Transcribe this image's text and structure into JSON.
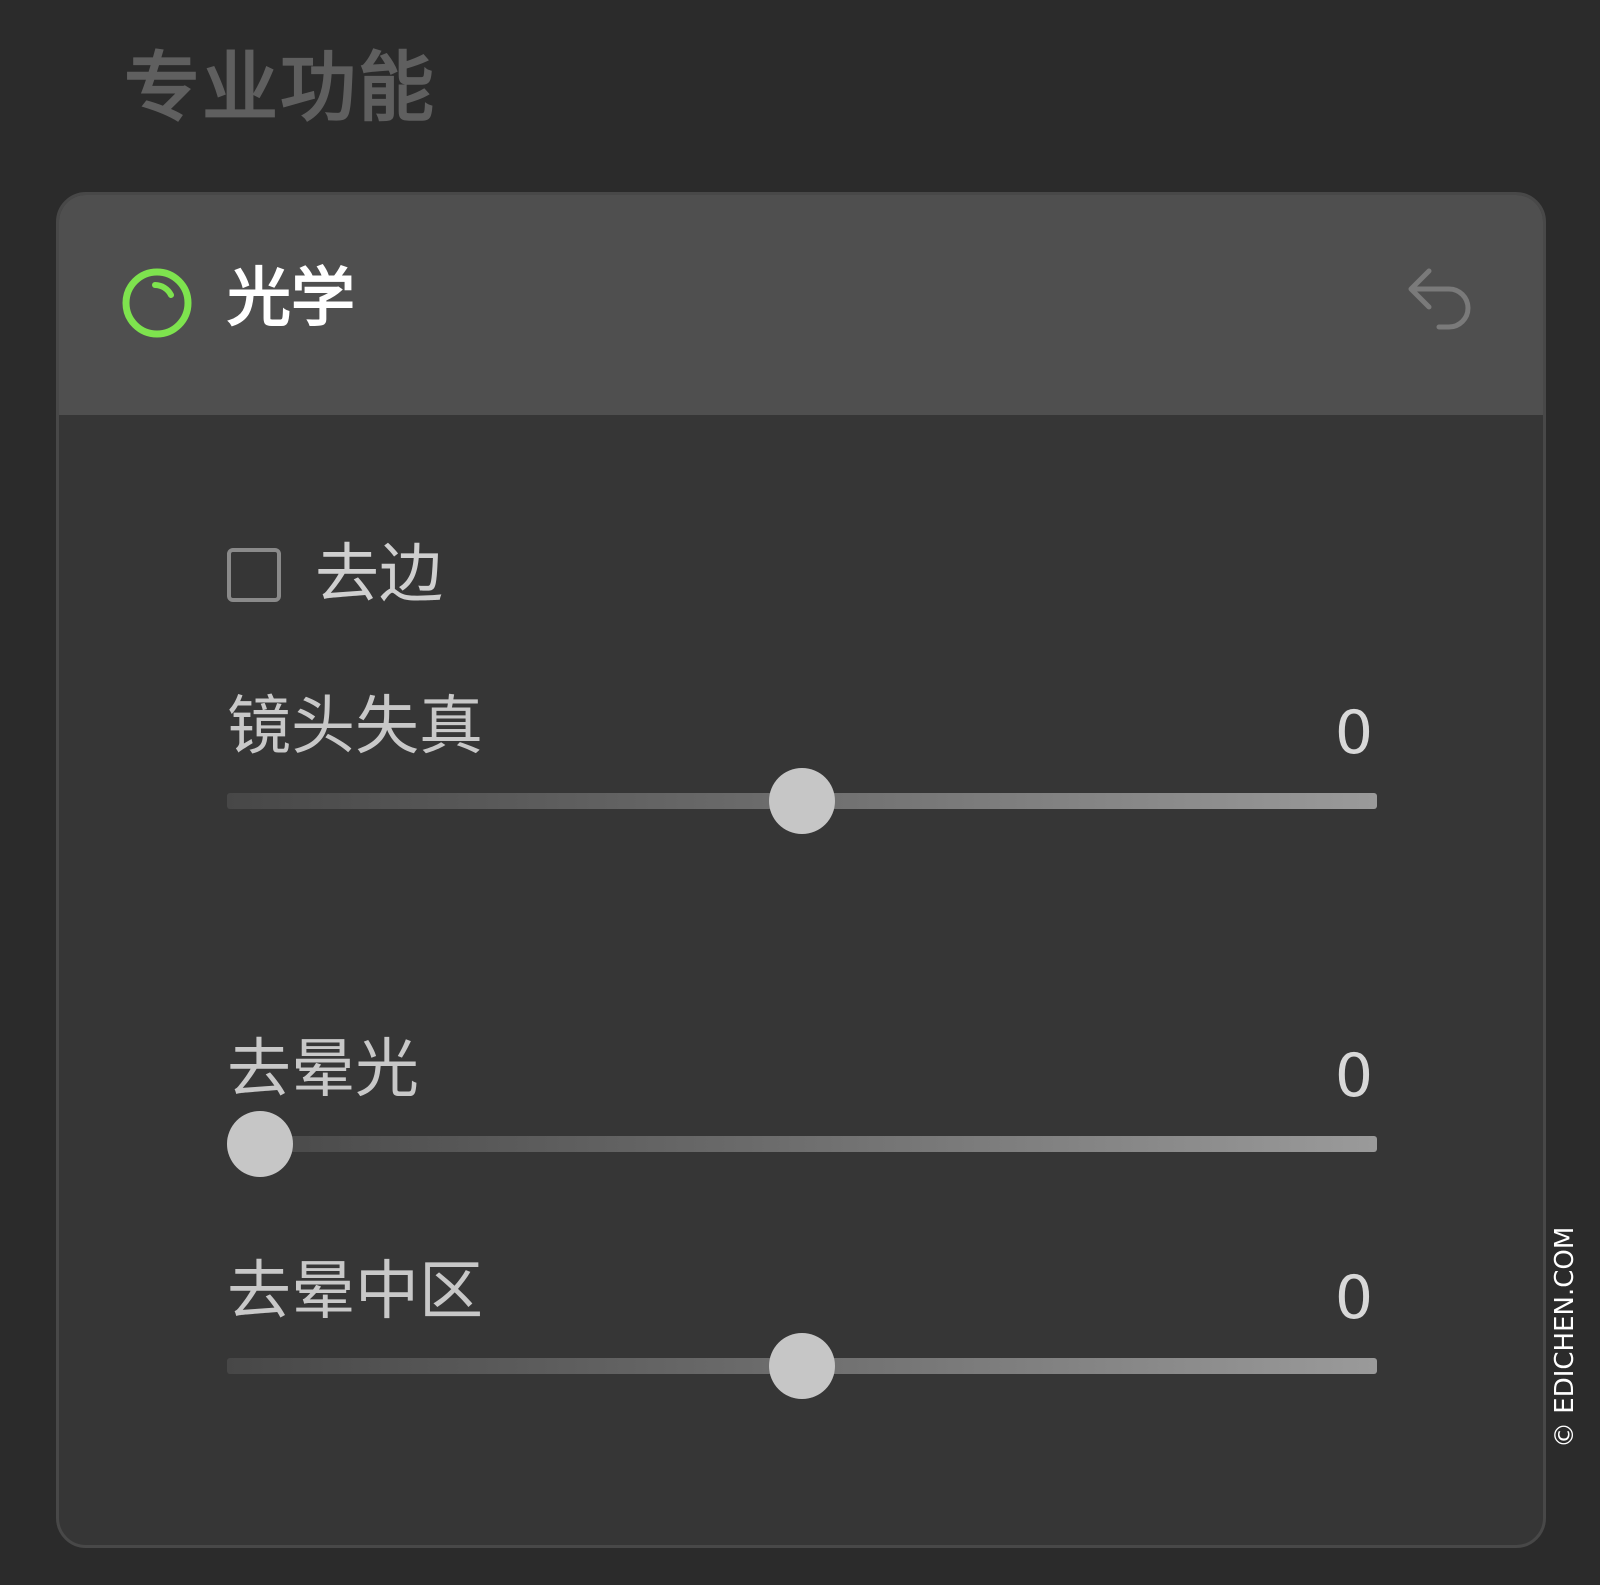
{
  "section": {
    "title": "专业功能"
  },
  "panel": {
    "title": "光学",
    "accent_color": "#7ee34e",
    "status_icon": "power-ring-icon",
    "reset_icon": "undo-arrow-icon",
    "defringe": {
      "label": "去边",
      "checked": false
    },
    "sliders": [
      {
        "label": "镜头失真",
        "value": "0",
        "thumb_position": 0.5
      },
      {
        "label": "去晕光",
        "value": "0",
        "thumb_position": 0.0
      },
      {
        "label": "去晕中区",
        "value": "0",
        "thumb_position": 0.5
      }
    ]
  },
  "watermark": "© EDICHEN.COM"
}
